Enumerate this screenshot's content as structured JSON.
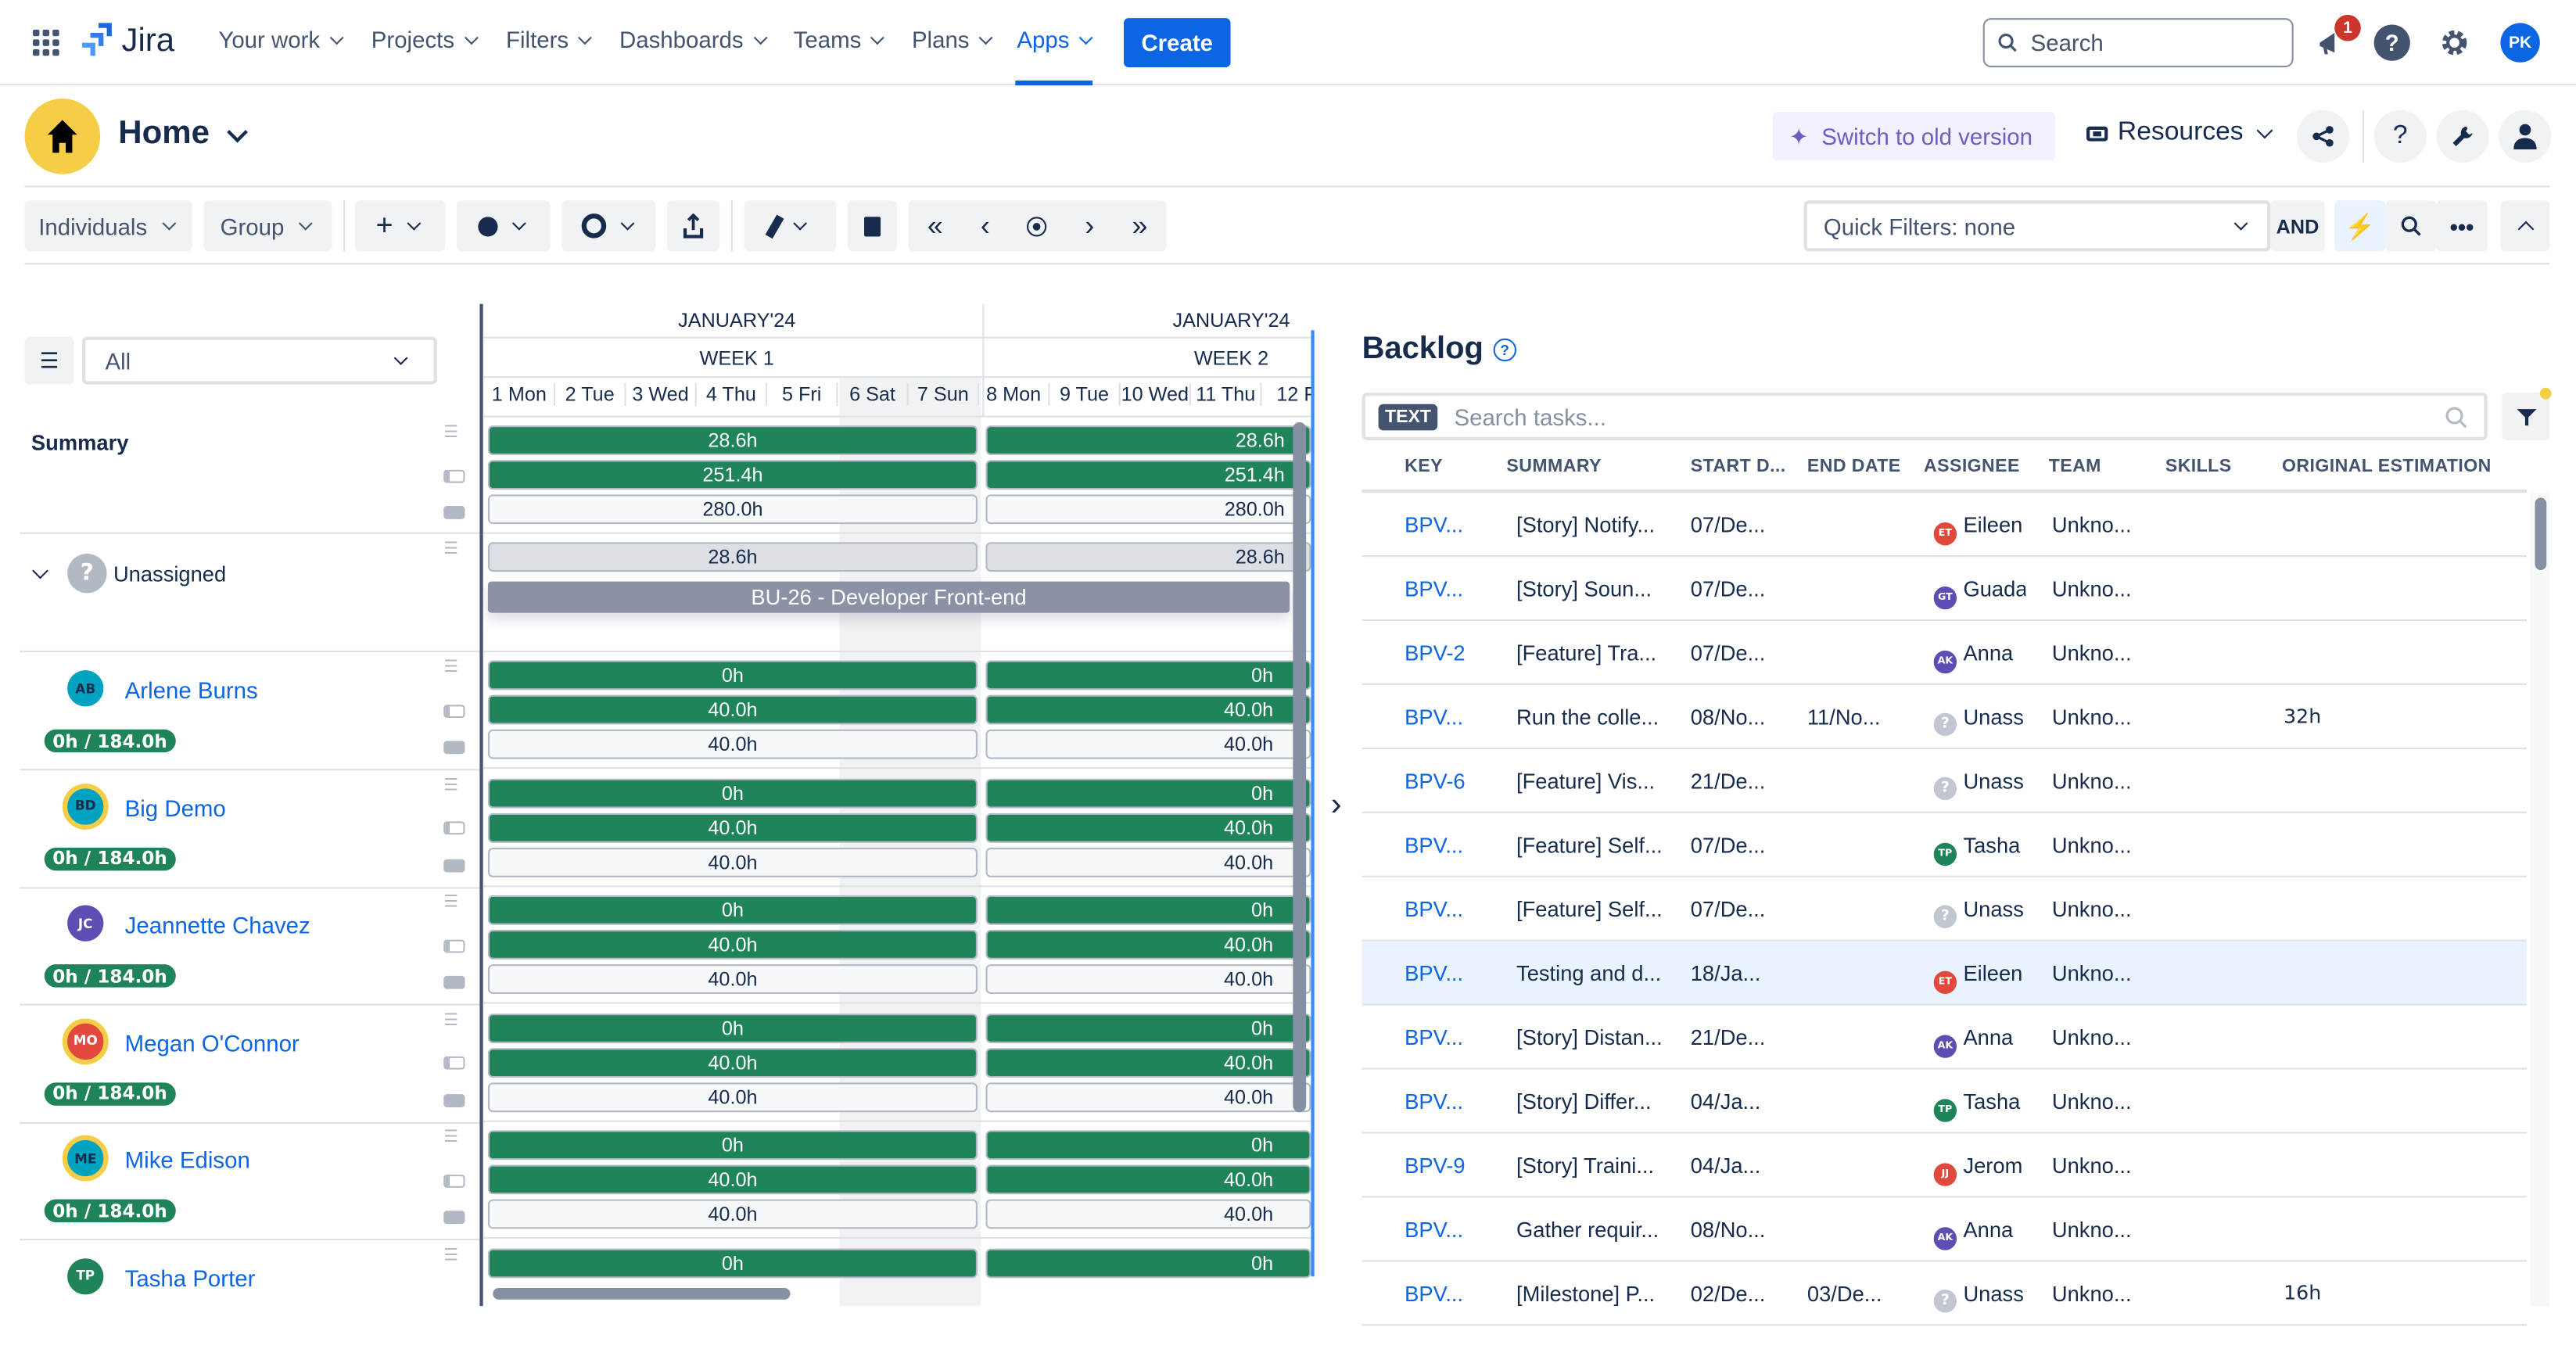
{
  "topnav": {
    "app_name": "Jira",
    "items": [
      {
        "label": "Your work"
      },
      {
        "label": "Projects"
      },
      {
        "label": "Filters"
      },
      {
        "label": "Dashboards"
      },
      {
        "label": "Teams"
      },
      {
        "label": "Plans"
      },
      {
        "label": "Apps",
        "active": true
      }
    ],
    "create_label": "Create",
    "search_placeholder": "Search",
    "notification_count": "1",
    "user_initials": "PK"
  },
  "header": {
    "title": "Home",
    "switch_label": "Switch to old version",
    "resources_label": "Resources"
  },
  "toolbar": {
    "individuals_label": "Individuals",
    "group_label": "Group",
    "quick_filters": "Quick Filters: none",
    "and_label": "AND"
  },
  "left_panel": {
    "filter_value": "All",
    "summary_label": "Summary",
    "unassigned_label": "Unassigned",
    "people": [
      {
        "initials": "AB",
        "name": "Arlene Burns",
        "hours": "0h / 184.0h",
        "color": "#00a3bf",
        "ring": false
      },
      {
        "initials": "BD",
        "name": "Big Demo",
        "hours": "0h / 184.0h",
        "color": "#00a3bf",
        "ring": true
      },
      {
        "initials": "JC",
        "name": "Jeannette Chavez",
        "hours": "0h / 184.0h",
        "color": "#5e4db2",
        "ring": false
      },
      {
        "initials": "MO",
        "name": "Megan O'Connor",
        "hours": "0h / 184.0h",
        "color": "#e2483d",
        "ring": true
      },
      {
        "initials": "ME",
        "name": "Mike Edison",
        "hours": "0h / 184.0h",
        "color": "#00a3bf",
        "ring": true
      },
      {
        "initials": "TP",
        "name": "Tasha Porter",
        "hours": "",
        "color": "#1f845a",
        "ring": false
      }
    ]
  },
  "timeline": {
    "months": [
      "JANUARY'24",
      "JANUARY'24"
    ],
    "weeks": [
      "WEEK 1",
      "WEEK 2"
    ],
    "days": [
      "1 Mon",
      "2 Tue",
      "3 Wed",
      "4 Thu",
      "5 Fri",
      "6 Sat",
      "7 Sun",
      "8 Mon",
      "9 Tue",
      "10 Wed",
      "11 Thu",
      "12 F"
    ],
    "summary_bars": [
      [
        "28.6h",
        "28.6h"
      ],
      [
        "251.4h",
        "251.4h"
      ],
      [
        "280.0h",
        "280.0h"
      ]
    ],
    "unassigned_bar": [
      "28.6h",
      "28.6h"
    ],
    "task_bar": "BU-26 - Developer Front-end",
    "person_bars": [
      [
        "0h",
        "40.0h",
        "40.0h"
      ],
      [
        "0h",
        "40.0h",
        "40.0h"
      ],
      [
        "0h",
        "40.0h",
        "40.0h"
      ],
      [
        "0h",
        "40.0h",
        "40.0h"
      ],
      [
        "0h",
        "40.0h",
        "40.0h"
      ],
      [
        "0h"
      ]
    ]
  },
  "backlog": {
    "title": "Backlog",
    "search_chip": "TEXT",
    "search_placeholder": "Search tasks...",
    "columns": [
      "KEY",
      "SUMMARY",
      "START D...",
      "END DATE",
      "ASSIGNEE",
      "TEAM",
      "SKILLS",
      "ORIGINAL ESTIMATION"
    ],
    "rows": [
      {
        "key": "BPV...",
        "summary": "[Story] Notify...",
        "start": "07/De...",
        "end": "",
        "assignee": "Eileen",
        "initials": "ET",
        "acolor": "#e2483d",
        "team": "Unkno...",
        "skills": "",
        "estimation": ""
      },
      {
        "key": "BPV...",
        "summary": "[Story] Soun...",
        "start": "07/De...",
        "end": "",
        "assignee": "Guada",
        "initials": "GT",
        "acolor": "#5e4db2",
        "team": "Unkno...",
        "skills": "",
        "estimation": ""
      },
      {
        "key": "BPV-2",
        "summary": "[Feature] Tra...",
        "start": "07/De...",
        "end": "",
        "assignee": "Anna",
        "initials": "AK",
        "acolor": "#5e4db2",
        "team": "Unkno...",
        "skills": "",
        "estimation": ""
      },
      {
        "key": "BPV...",
        "summary": "Run the colle...",
        "start": "08/No...",
        "end": "11/No...",
        "assignee": "Unass",
        "initials": "?",
        "acolor": "#c1c7d0",
        "team": "Unkno...",
        "skills": "",
        "estimation": "32h"
      },
      {
        "key": "BPV-6",
        "summary": "[Feature] Vis...",
        "start": "21/De...",
        "end": "",
        "assignee": "Unass",
        "initials": "?",
        "acolor": "#c1c7d0",
        "team": "Unkno...",
        "skills": "",
        "estimation": ""
      },
      {
        "key": "BPV...",
        "summary": "[Feature] Self...",
        "start": "07/De...",
        "end": "",
        "assignee": "Tasha",
        "initials": "TP",
        "acolor": "#1f845a",
        "team": "Unkno...",
        "skills": "",
        "estimation": ""
      },
      {
        "key": "BPV...",
        "summary": "[Feature] Self...",
        "start": "07/De...",
        "end": "",
        "assignee": "Unass",
        "initials": "?",
        "acolor": "#c1c7d0",
        "team": "Unkno...",
        "skills": "",
        "estimation": ""
      },
      {
        "key": "BPV...",
        "summary": "Testing and d...",
        "start": "18/Ja...",
        "end": "",
        "assignee": "Eileen",
        "initials": "ET",
        "acolor": "#e2483d",
        "team": "Unkno...",
        "skills": "",
        "estimation": "",
        "selected": true
      },
      {
        "key": "BPV...",
        "summary": "[Story] Distan...",
        "start": "21/De...",
        "end": "",
        "assignee": "Anna",
        "initials": "AK",
        "acolor": "#5e4db2",
        "team": "Unkno...",
        "skills": "",
        "estimation": ""
      },
      {
        "key": "BPV...",
        "summary": "[Story] Differ...",
        "start": "04/Ja...",
        "end": "",
        "assignee": "Tasha",
        "initials": "TP",
        "acolor": "#1f845a",
        "team": "Unkno...",
        "skills": "",
        "estimation": ""
      },
      {
        "key": "BPV-9",
        "summary": "[Story] Traini...",
        "start": "04/Ja...",
        "end": "",
        "assignee": "Jerom",
        "initials": "JJ",
        "acolor": "#e2483d",
        "team": "Unkno...",
        "skills": "",
        "estimation": ""
      },
      {
        "key": "BPV...",
        "summary": "Gather requir...",
        "start": "08/No...",
        "end": "",
        "assignee": "Anna",
        "initials": "AK",
        "acolor": "#5e4db2",
        "team": "Unkno...",
        "skills": "",
        "estimation": ""
      },
      {
        "key": "BPV...",
        "summary": "[Milestone] P...",
        "start": "02/De...",
        "end": "03/De...",
        "assignee": "Unass",
        "initials": "?",
        "acolor": "#c1c7d0",
        "team": "Unkno...",
        "skills": "",
        "estimation": "16h"
      }
    ]
  }
}
